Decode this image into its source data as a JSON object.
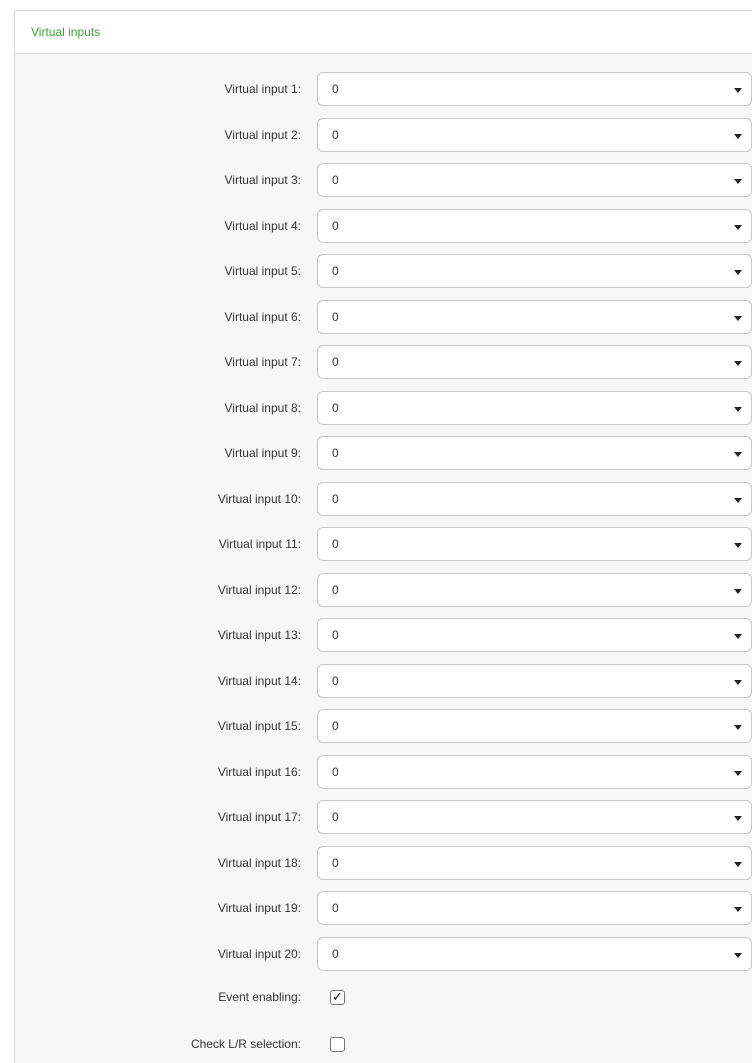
{
  "panel": {
    "title": "Virtual inputs"
  },
  "virtual_inputs": [
    {
      "label": "Virtual input 1:",
      "value": "0"
    },
    {
      "label": "Virtual input 2:",
      "value": "0"
    },
    {
      "label": "Virtual input 3:",
      "value": "0"
    },
    {
      "label": "Virtual input 4:",
      "value": "0"
    },
    {
      "label": "Virtual input 5:",
      "value": "0"
    },
    {
      "label": "Virtual input 6:",
      "value": "0"
    },
    {
      "label": "Virtual input 7:",
      "value": "0"
    },
    {
      "label": "Virtual input 8:",
      "value": "0"
    },
    {
      "label": "Virtual input 9:",
      "value": "0"
    },
    {
      "label": "Virtual input 10:",
      "value": "0"
    },
    {
      "label": "Virtual input 11:",
      "value": "0"
    },
    {
      "label": "Virtual input 12:",
      "value": "0"
    },
    {
      "label": "Virtual input 13:",
      "value": "0"
    },
    {
      "label": "Virtual input 14:",
      "value": "0"
    },
    {
      "label": "Virtual input 15:",
      "value": "0"
    },
    {
      "label": "Virtual input 16:",
      "value": "0"
    },
    {
      "label": "Virtual input 17:",
      "value": "0"
    },
    {
      "label": "Virtual input 18:",
      "value": "0"
    },
    {
      "label": "Virtual input 19:",
      "value": "0"
    },
    {
      "label": "Virtual input 20:",
      "value": "0"
    }
  ],
  "event_enabling": {
    "label": "Event enabling:",
    "checked": true
  },
  "check_lr_selection": {
    "label": "Check L/R selection:",
    "checked": false
  }
}
